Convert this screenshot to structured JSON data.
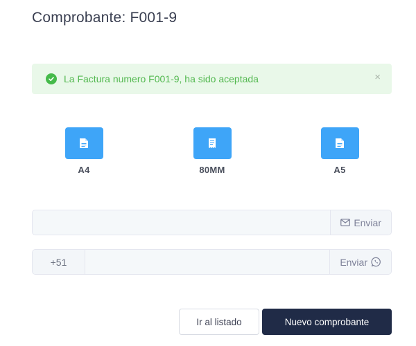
{
  "header": {
    "title": "Comprobante: F001-9"
  },
  "alert": {
    "message": "La Factura numero F001-9, ha sido aceptada",
    "icon": "check-circle-icon",
    "close_label": "×",
    "color": "#52b84f",
    "background": "#e9f8e9"
  },
  "formats": [
    {
      "label": "A4",
      "icon": "document-icon"
    },
    {
      "label": "80MM",
      "icon": "receipt-icon"
    },
    {
      "label": "A5",
      "icon": "document-icon"
    }
  ],
  "email": {
    "value": "",
    "placeholder": "",
    "send_label": "Enviar",
    "icon": "envelope-icon"
  },
  "whatsapp": {
    "prefix": "+51",
    "value": "",
    "placeholder": "",
    "send_label": "Enviar",
    "icon": "whatsapp-icon"
  },
  "actions": {
    "list_label": "Ir al listado",
    "new_label": "Nuevo comprobante"
  },
  "colors": {
    "accent": "#3ea5f8",
    "primary_dark": "#202b47"
  }
}
